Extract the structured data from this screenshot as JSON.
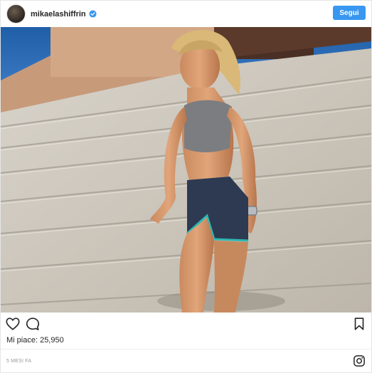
{
  "post": {
    "username": "mikaelashiffrin",
    "follow_label": "Segui",
    "likes_label": "Mi piace: 25,950",
    "timestamp": "5 MESI FA"
  },
  "icons": {
    "verified": "verified-badge-icon",
    "like": "heart-icon",
    "comment": "comment-icon",
    "save": "bookmark-icon",
    "brand": "instagram-icon"
  },
  "colors": {
    "accent": "#3897f0",
    "text": "#262626",
    "muted": "#999999"
  }
}
